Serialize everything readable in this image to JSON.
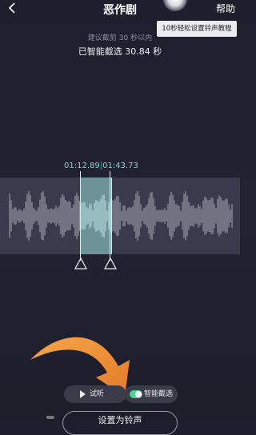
{
  "header": {
    "title": "恶作剧",
    "help_label": "帮助"
  },
  "tooltip": {
    "text": "10秒轻松设置铃声教程"
  },
  "hint": {
    "text": "建议截剪 30 秒以内"
  },
  "selection": {
    "text": "已智能截选 30.84 秒",
    "start_time": "01:12.89",
    "end_time": "01:43.73"
  },
  "controls": {
    "play_label": "试听",
    "smart_select_label": "智能截选",
    "smart_select_on": true,
    "set_button_label": "设置为铃声"
  },
  "colors": {
    "accent_teal": "#7fd6d6",
    "toggle_green": "#4fd28f",
    "arrow_orange": "#f0923a"
  }
}
